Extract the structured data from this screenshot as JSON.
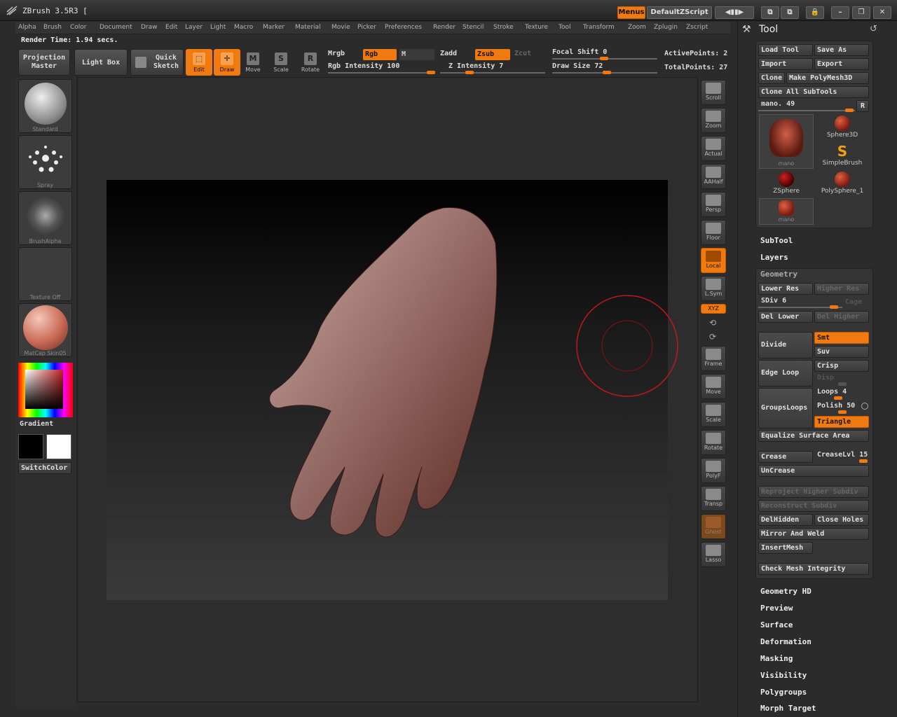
{
  "window": {
    "title": "ZBrush 3.5R3 [",
    "menus_btn": "Menus",
    "zscript_btn": "DefaultZScript"
  },
  "menubar": [
    "Alpha",
    "Brush",
    "Color",
    "Document",
    "Draw",
    "Edit",
    "Layer",
    "Light",
    "Macro",
    "Marker",
    "Material",
    "Movie",
    "Picker",
    "Preferences",
    "Render",
    "Stencil",
    "Stroke",
    "Texture",
    "Tool",
    "Transform",
    "Zoom",
    "Zplugin",
    "Zscript"
  ],
  "render_time": "Render Time: 1.94 secs.",
  "shelf": {
    "projection_master": "Projection Master",
    "light_box": "Light Box",
    "quick_sketch": "Quick Sketch",
    "edit": "Edit",
    "draw": "Draw",
    "move": "Move",
    "scale": "Scale",
    "rotate": "Rotate",
    "mrgb": "Mrgb",
    "rgb": "Rgb",
    "m": "M",
    "rgb_intensity": "Rgb Intensity 100",
    "zadd": "Zadd",
    "zsub": "Zsub",
    "zcut": "Zcut",
    "z_intensity": "Z Intensity 7",
    "focal_shift": "Focal Shift 0",
    "draw_size": "Draw Size 72",
    "active_points": "ActivePoints: 2",
    "total_points": "TotalPoints: 27"
  },
  "leftshelf": {
    "brush": "Standard",
    "stroke": "Spray",
    "alpha": "BrushAlpha",
    "texture": "Texture Off",
    "material": "MatCap Skin05",
    "gradient": "Gradient",
    "switchcolor": "SwitchColor"
  },
  "rightshelf": [
    "Scroll",
    "Zoom",
    "Actual",
    "AAHalf",
    "Persp",
    "Floor",
    "Local",
    "L.Sym",
    "XYZ",
    "Frame",
    "Move",
    "Scale",
    "Rotate",
    "PolyF",
    "Transp",
    "Ghost",
    "Lasso"
  ],
  "toolpanel": {
    "title": "Tool",
    "load_tool": "Load Tool",
    "save_as": "Save As",
    "import": "Import",
    "export": "Export",
    "clone": "Clone",
    "make_polymesh": "Make PolyMesh3D",
    "clone_all": "Clone All SubTools",
    "mano_slider": "mano. 49",
    "r": "R",
    "subtools": [
      "mano",
      "Sphere3D",
      "SimpleBrush",
      "ZSphere",
      "PolySphere_1",
      "mano"
    ],
    "subtool": "SubTool",
    "layers": "Layers",
    "geometry": "Geometry",
    "lower_res": "Lower Res",
    "higher_res": "Higher Res",
    "sdiv": "SDiv 6",
    "cage": "Cage",
    "del_lower": "Del Lower",
    "del_higher": "Del Higher",
    "divide": "Divide",
    "smt": "Smt",
    "suv": "Suv",
    "edge_loop": "Edge Loop",
    "crisp": "Crisp",
    "disp": "Disp",
    "loops": "Loops 4",
    "groupsloops": "GroupsLoops",
    "polish": "Polish 50",
    "triangle": "Triangle",
    "equalize": "Equalize Surface Area",
    "crease": "Crease",
    "creaselvl": "CreaseLvl 15",
    "uncrease": "UnCrease",
    "reproject": "Reproject Higher Subdiv",
    "reconstruct": "Reconstruct Subdiv",
    "delhidden": "DelHidden",
    "close_holes": "Close Holes",
    "mirror_weld": "Mirror And Weld",
    "insertmesh": "InsertMesh",
    "check_mesh": "Check Mesh Integrity",
    "sections": [
      "Geometry HD",
      "Preview",
      "Surface",
      "Deformation",
      "Masking",
      "Visibility",
      "Polygroups",
      "Morph Target"
    ]
  }
}
